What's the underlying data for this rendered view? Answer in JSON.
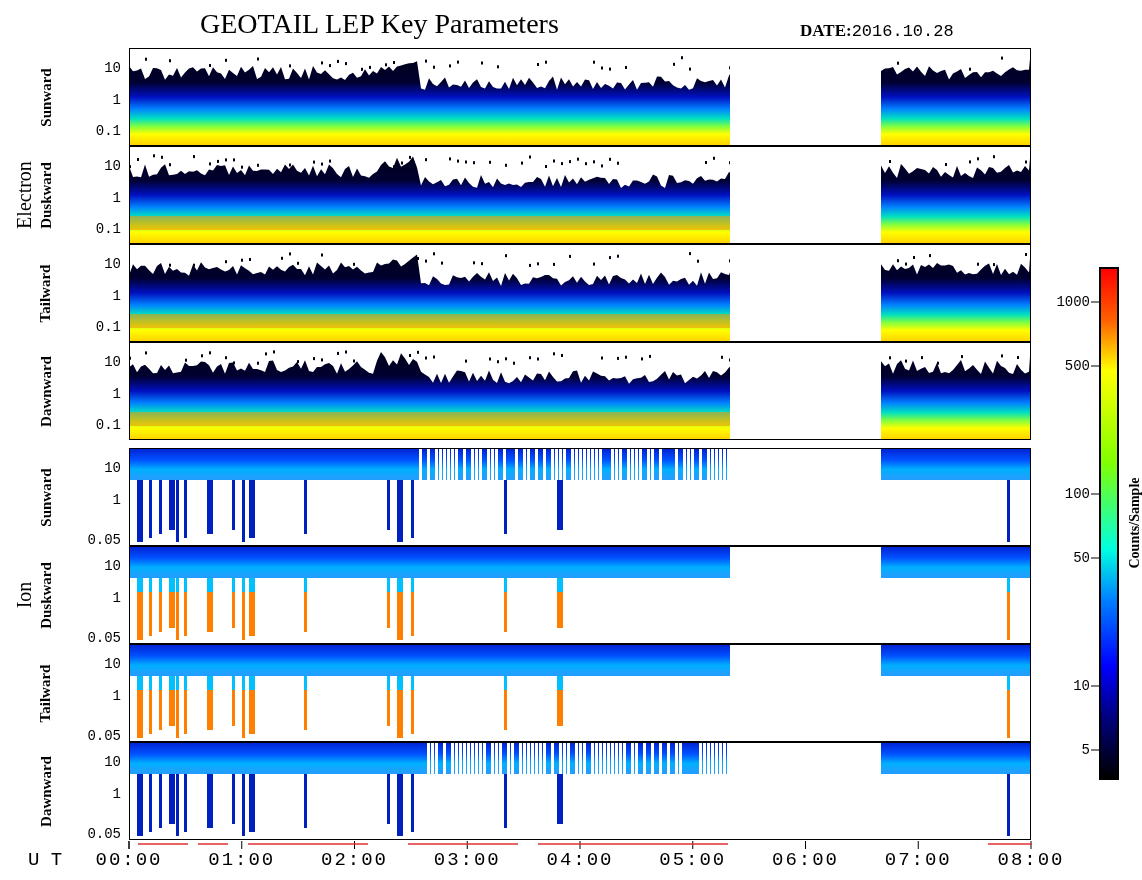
{
  "title": "GEOTAIL LEP Key Parameters",
  "date": {
    "label": "DATE:",
    "value": "2016.10.28"
  },
  "groups": [
    {
      "label": "Electron",
      "panels": [
        {
          "label": "Sunward",
          "yticks": [
            "10",
            "1",
            "0.1"
          ]
        },
        {
          "label": "Duskward",
          "yticks": [
            "10",
            "1",
            "0.1"
          ]
        },
        {
          "label": "Tailward",
          "yticks": [
            "10",
            "1",
            "0.1"
          ]
        },
        {
          "label": "Dawnward",
          "yticks": [
            "10",
            "1",
            "0.1"
          ]
        }
      ]
    },
    {
      "label": "Ion",
      "panels": [
        {
          "label": "Sunward",
          "yticks": [
            "10",
            "1",
            "0.05"
          ]
        },
        {
          "label": "Duskward",
          "yticks": [
            "10",
            "1",
            "0.05"
          ]
        },
        {
          "label": "Tailward",
          "yticks": [
            "10",
            "1",
            "0.05"
          ]
        },
        {
          "label": "Dawnward",
          "yticks": [
            "10",
            "1",
            "0.05"
          ]
        }
      ]
    }
  ],
  "x_axis": {
    "label": "U T",
    "ticks": [
      "00:00",
      "01:00",
      "02:00",
      "03:00",
      "04:00",
      "05:00",
      "06:00",
      "07:00",
      "08:00"
    ]
  },
  "colorbar": {
    "label": "Counts/Sample",
    "ticks": [
      "1000",
      "500",
      "100",
      "50",
      "10",
      "5"
    ]
  }
}
